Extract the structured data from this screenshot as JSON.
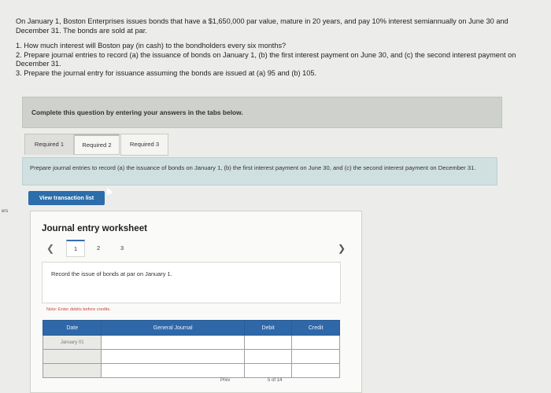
{
  "problem": {
    "intro": "On January 1, Boston Enterprises issues bonds that have a $1,650,000 par value, mature in 20 years, and pay 10% interest semiannually on June 30 and December 31. The bonds are sold at par.",
    "q1": "1. How much interest will Boston pay (in cash) to the bondholders every six months?",
    "q2": "2. Prepare journal entries to record (a) the issuance of bonds on January 1, (b) the first interest payment on June 30, and (c) the second interest payment on December 31.",
    "q3": "3. Prepare the journal entry for issuance assuming the bonds are issued at (a) 95 and (b) 105."
  },
  "banner": "Complete this question by entering your answers in the tabs below.",
  "tabs": [
    {
      "label": "Required 1"
    },
    {
      "label": "Required 2"
    },
    {
      "label": "Required 3"
    }
  ],
  "instruction": "Prepare journal entries to record (a) the issuance of bonds on January 1, (b) the first interest payment on June 30, and (c) the second interest payment on December 31.",
  "view_transaction_list": "View transaction list",
  "worksheet": {
    "title": "Journal entry worksheet",
    "pages": [
      "1",
      "2",
      "3"
    ],
    "record_text": "Record the issue of bonds at par on January 1.",
    "note": "Note: Enter debits before credits.",
    "columns": {
      "date": "Date",
      "journal": "General Journal",
      "debit": "Debit",
      "credit": "Credit"
    },
    "rows": [
      {
        "date": "January 01"
      },
      {
        "date": ""
      },
      {
        "date": ""
      }
    ]
  },
  "edge_text": "ers",
  "bottom_nav": {
    "prev": "Prev",
    "page_info": "5 of 14"
  },
  "colors": {
    "primary": "#2c6dab",
    "table_header": "#2f68a8",
    "banner": "#cfd1cc",
    "instruction_bg": "#d0dfe0"
  }
}
